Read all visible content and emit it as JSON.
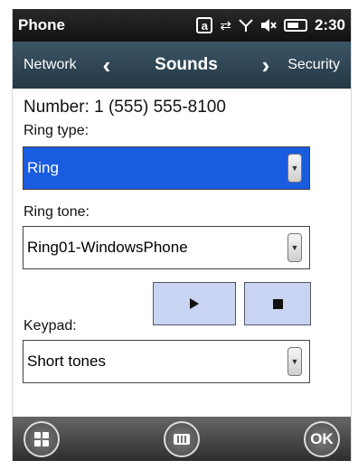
{
  "statusbar": {
    "title": "Phone",
    "icons": [
      "at-sign-icon",
      "data-transfer-icon",
      "signal-icon",
      "speaker-muted-icon",
      "battery-icon"
    ],
    "time": "2:30"
  },
  "navbar": {
    "prev_label": "Network",
    "title": "Sounds",
    "next_label": "Security"
  },
  "content": {
    "number": "Number: 1 (555) 555-8100",
    "ring_type": {
      "label": "Ring type:",
      "value": "Ring"
    },
    "ring_tone": {
      "label": "Ring tone:",
      "value": "Ring01-WindowsPhone"
    },
    "keypad": {
      "label": "Keypad:",
      "value": "Short tones"
    }
  },
  "bottombar": {
    "ok_label": "OK"
  },
  "colors": {
    "selected_bg": "#1a5ce0",
    "nav_bg": "#2f4656",
    "media_button_bg": "#c9d4f2"
  }
}
